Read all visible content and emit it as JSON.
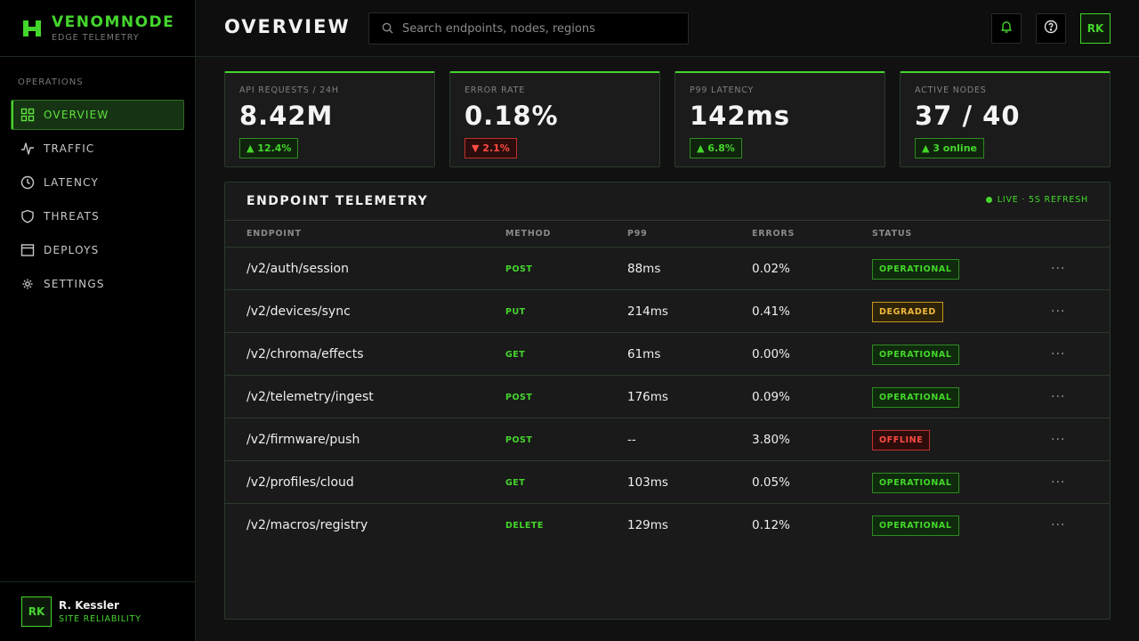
{
  "brand": {
    "name": "VENOMNODE",
    "subtitle": "EDGE TELEMETRY"
  },
  "sidebar": {
    "section_label": "OPERATIONS",
    "items": [
      {
        "label": "OVERVIEW",
        "icon": "grid-icon",
        "active": true
      },
      {
        "label": "TRAFFIC",
        "icon": "pulse-icon",
        "active": false
      },
      {
        "label": "LATENCY",
        "icon": "clock-icon",
        "active": false
      },
      {
        "label": "THREATS",
        "icon": "shield-icon",
        "active": false
      },
      {
        "label": "DEPLOYS",
        "icon": "window-icon",
        "active": false
      },
      {
        "label": "SETTINGS",
        "icon": "gear-icon",
        "active": false
      }
    ]
  },
  "user": {
    "initials": "RK",
    "name": "R. Kessler",
    "role": "SITE RELIABILITY"
  },
  "header": {
    "title": "OVERVIEW",
    "search_placeholder": "Search endpoints, nodes, regions",
    "avatar_initials": "RK"
  },
  "kpis": [
    {
      "label": "API REQUESTS / 24H",
      "value": "8.42M",
      "delta": "▲ 12.4%",
      "trend": "up"
    },
    {
      "label": "ERROR RATE",
      "value": "0.18%",
      "delta": "▼ 2.1%",
      "trend": "down"
    },
    {
      "label": "P99 LATENCY",
      "value": "142ms",
      "delta": "▲ 6.8%",
      "trend": "up"
    },
    {
      "label": "ACTIVE NODES",
      "value": "37 / 40",
      "delta": "▲ 3 online",
      "trend": "up"
    }
  ],
  "table": {
    "title": "ENDPOINT TELEMETRY",
    "live_label": "LIVE · 5S REFRESH",
    "columns": [
      "ENDPOINT",
      "METHOD",
      "P99",
      "ERRORS",
      "STATUS"
    ],
    "rows": [
      {
        "endpoint": "/v2/auth/session",
        "method": "POST",
        "p99": "88ms",
        "errors": "0.02%",
        "status": "OPERATIONAL",
        "level": "ok"
      },
      {
        "endpoint": "/v2/devices/sync",
        "method": "PUT",
        "p99": "214ms",
        "errors": "0.41%",
        "status": "DEGRADED",
        "level": "warn"
      },
      {
        "endpoint": "/v2/chroma/effects",
        "method": "GET",
        "p99": "61ms",
        "errors": "0.00%",
        "status": "OPERATIONAL",
        "level": "ok"
      },
      {
        "endpoint": "/v2/telemetry/ingest",
        "method": "POST",
        "p99": "176ms",
        "errors": "0.09%",
        "status": "OPERATIONAL",
        "level": "ok"
      },
      {
        "endpoint": "/v2/firmware/push",
        "method": "POST",
        "p99": "--",
        "errors": "3.80%",
        "status": "OFFLINE",
        "level": "down"
      },
      {
        "endpoint": "/v2/profiles/cloud",
        "method": "GET",
        "p99": "103ms",
        "errors": "0.05%",
        "status": "OPERATIONAL",
        "level": "ok"
      },
      {
        "endpoint": "/v2/macros/registry",
        "method": "DELETE",
        "p99": "129ms",
        "errors": "0.12%",
        "status": "OPERATIONAL",
        "level": "ok"
      }
    ],
    "row_action_label": "···"
  },
  "colors": {
    "accent": "#44d62c",
    "warning": "#f0b93a",
    "danger": "#ff4c43",
    "background": "#111111"
  }
}
